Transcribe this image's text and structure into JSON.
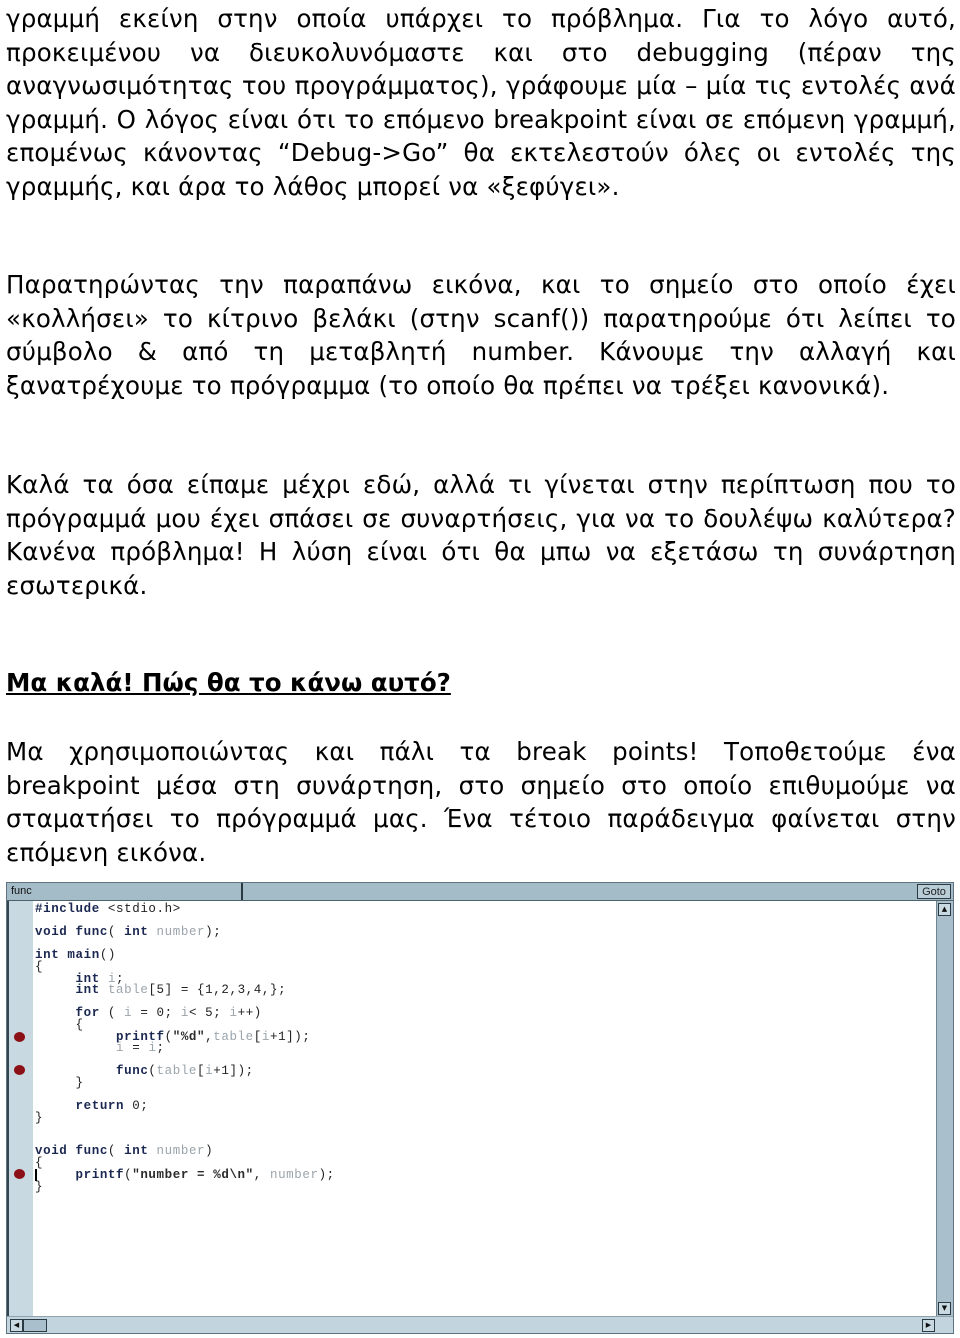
{
  "paragraphs": [
    "γραμμή εκείνη στην οποία υπάρχει το πρόβλημα. Για το λόγο αυτό, προκειμένου να διευκολυνόμαστε και στο debugging (πέραν της αναγνωσιμότητας του προγράμματος), γράφουμε μία – μία τις εντολές ανά γραμμή. Ο λόγος είναι ότι το επόμενο breakpoint είναι σε επόμενη γραμμή, επομένως κάνοντας “Debug->Go” θα εκτελεστούν όλες οι εντολές της γραμμής, και άρα το λάθος μπορεί να «ξεφύγει».",
    "Παρατηρώντας την παραπάνω εικόνα, και το σημείο στο οποίο έχει «κολλήσει» το κίτρινο βελάκι (στην scanf()) παρατηρούμε ότι λείπει το σύμβολο & από τη μεταβλητή number. Κάνουμε την αλλαγή και ξανατρέχουμε το πρόγραμμα (το οποίο θα πρέπει να τρέξει κανονικά).",
    "Καλά τα όσα είπαμε μέχρι εδώ, αλλά τι γίνεται στην περίπτωση που το πρόγραμμά μου έχει σπάσει σε συναρτήσεις, για να το δουλέψω καλύτερα? Κανένα πρόβλημα! Η λύση είναι ότι θα μπω να εξετάσω τη συνάρτηση εσωτερικά."
  ],
  "heading": "Μα καλά! Πώς θα το κάνω αυτό?",
  "paragraph_after_heading": "Μα χρησιμοποιώντας και πάλι τα break points! Τοποθετούμε ένα breakpoint μέσα στη συνάρτηση, στο σημείο στο οποίο επιθυμούμε να σταματήσει το πρόγραμμά μας. Ένα τέτοιο παράδειγμα φαίνεται στην επόμενη εικόνα.",
  "editor": {
    "function_selector": "func",
    "goto_label": "Goto",
    "scroll_up_icon": "▲",
    "scroll_down_icon": "▼",
    "scroll_left_icon": "◀",
    "scroll_right_icon": "▶",
    "breakpoint_color": "#8b1116",
    "code_lines": [
      {
        "text": "#include <stdio.h>",
        "breakpoint": false
      },
      {
        "text": "void func( int number);",
        "breakpoint": false
      },
      {
        "text": "int main()",
        "breakpoint": false
      },
      {
        "text": "{",
        "breakpoint": false
      },
      {
        "text": "     int i;",
        "breakpoint": false
      },
      {
        "text": "     int table[5] = {1,2,3,4,};",
        "breakpoint": false
      },
      {
        "text": "     for ( i = 0; i< 5; i++)",
        "breakpoint": false
      },
      {
        "text": "     {",
        "breakpoint": false
      },
      {
        "text": "          printf(\"%d\",table[i+1]);",
        "breakpoint": true
      },
      {
        "text": "          i = i;",
        "breakpoint": false
      },
      {
        "text": "          func(table[i+1]);",
        "breakpoint": true
      },
      {
        "text": "     }",
        "breakpoint": false
      },
      {
        "text": "     return 0;",
        "breakpoint": false
      },
      {
        "text": "}",
        "breakpoint": false
      },
      {
        "text": "void func( int number)",
        "breakpoint": false
      },
      {
        "text": "{",
        "breakpoint": false
      },
      {
        "text": "     printf(\"number = %d\\n\", number);",
        "breakpoint": true
      },
      {
        "text": "}",
        "breakpoint": false
      }
    ]
  }
}
